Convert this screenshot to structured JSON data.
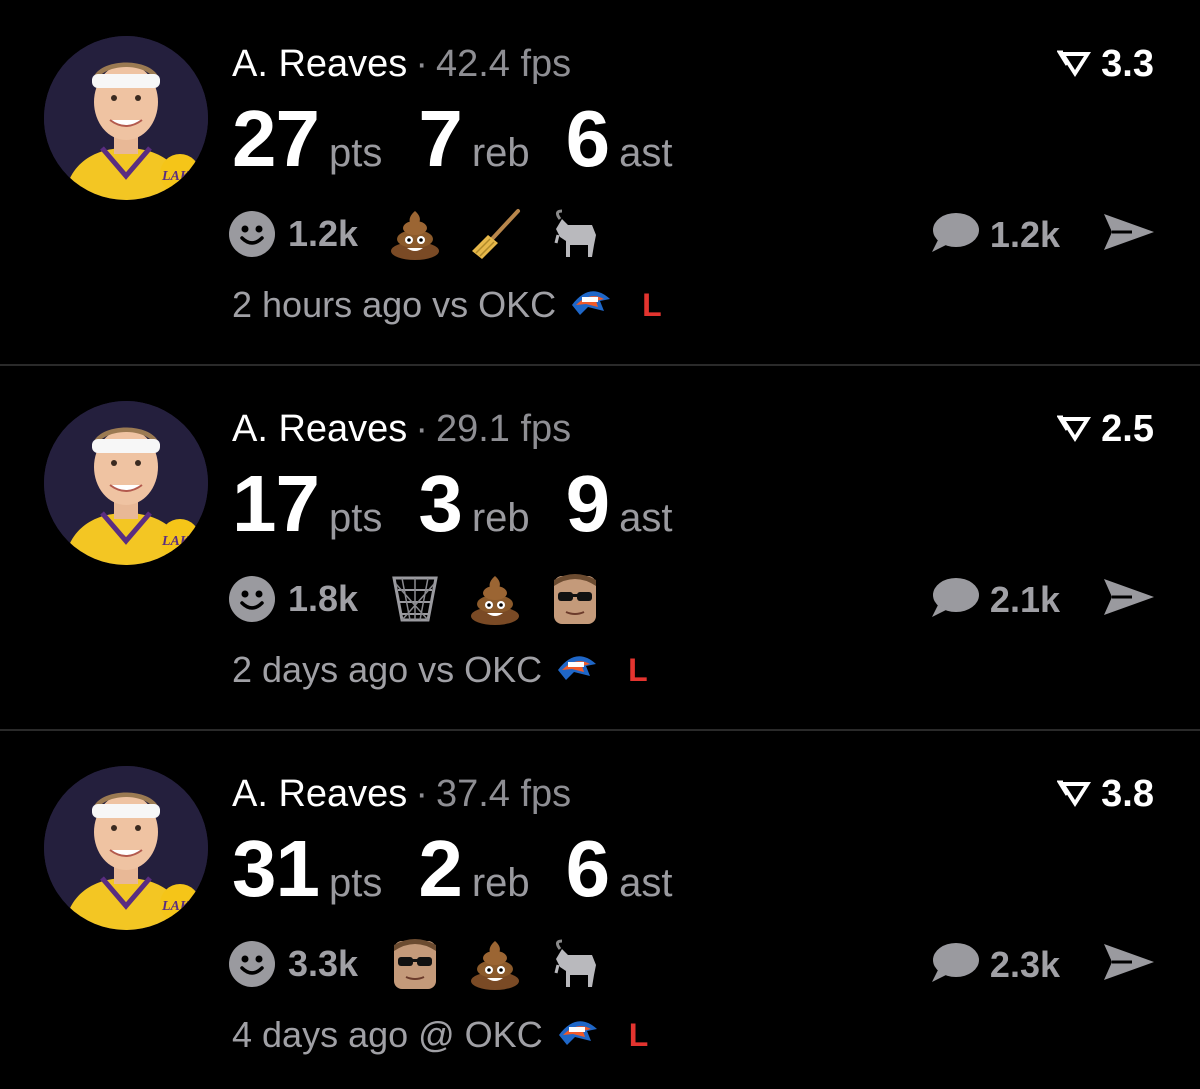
{
  "posts": [
    {
      "player": "A. Reaves",
      "separator": "·",
      "fps": "42.4 fps",
      "rank": "3.3",
      "stats": [
        {
          "value": "27",
          "unit": "pts"
        },
        {
          "value": "7",
          "unit": "reb"
        },
        {
          "value": "6",
          "unit": "ast"
        }
      ],
      "reaction_count": "1.2k",
      "emojis": [
        "poop-icon",
        "broom-icon",
        "goat-icon"
      ],
      "comment_count": "1.2k",
      "time": "2 hours ago vs OKC",
      "result": "L"
    },
    {
      "player": "A. Reaves",
      "separator": "·",
      "fps": "29.1 fps",
      "rank": "2.5",
      "stats": [
        {
          "value": "17",
          "unit": "pts"
        },
        {
          "value": "3",
          "unit": "reb"
        },
        {
          "value": "9",
          "unit": "ast"
        }
      ],
      "reaction_count": "1.8k",
      "emojis": [
        "basket-icon",
        "poop-icon",
        "face-sunglasses-icon"
      ],
      "comment_count": "2.1k",
      "time": "2 days ago vs OKC",
      "result": "L"
    },
    {
      "player": "A. Reaves",
      "separator": "·",
      "fps": "37.4 fps",
      "rank": "3.8",
      "stats": [
        {
          "value": "31",
          "unit": "pts"
        },
        {
          "value": "2",
          "unit": "reb"
        },
        {
          "value": "6",
          "unit": "ast"
        }
      ],
      "reaction_count": "3.3k",
      "emojis": [
        "face-sunglasses-icon",
        "poop-icon",
        "goat-icon"
      ],
      "comment_count": "2.3k",
      "time": "4 days ago @ OKC",
      "result": "L"
    }
  ],
  "colors": {
    "background": "#000000",
    "muted_text": "#a0a0a5",
    "loss": "#e3342f",
    "divider": "#2a2a2a",
    "avatar_bg": "#241f3d",
    "lakers_gold": "#f5c518"
  }
}
